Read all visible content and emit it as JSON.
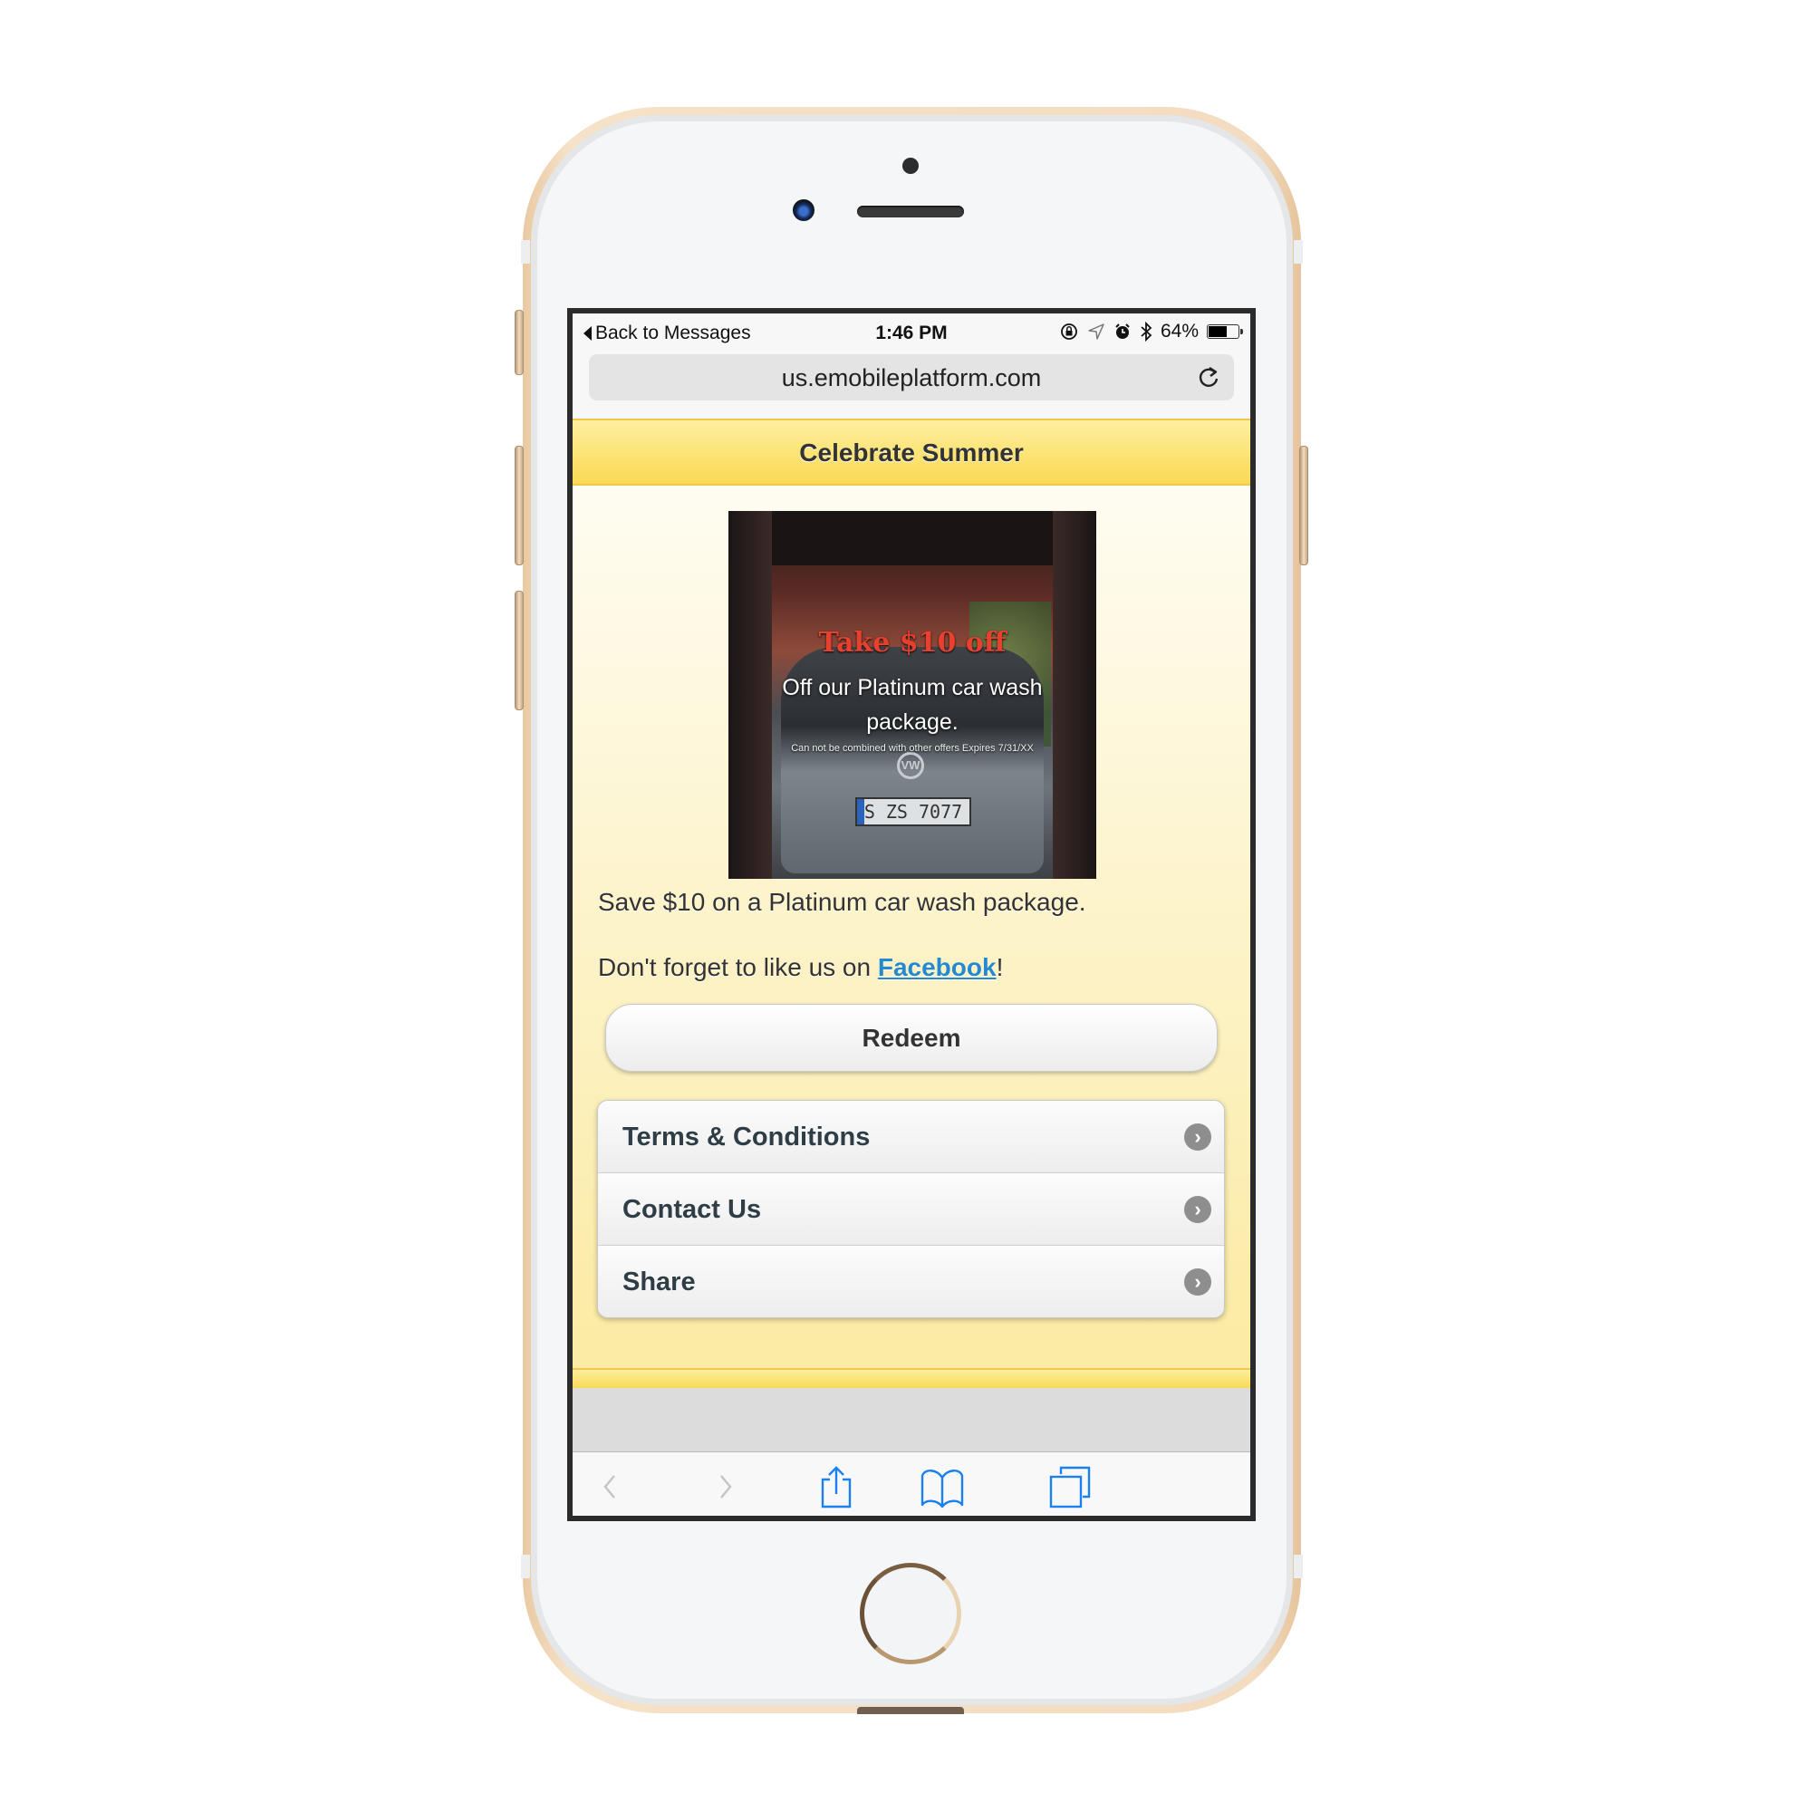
{
  "device": {
    "model": "iPhone",
    "finish": "gold"
  },
  "status_bar": {
    "back_label": "Back to Messages",
    "time": "1:46 PM",
    "icons": [
      "orientation-lock-icon",
      "location-icon",
      "alarm-icon",
      "bluetooth-icon"
    ],
    "battery_percent_label": "64%",
    "battery_level": 0.64
  },
  "browser": {
    "url": "us.emobileplatform.com",
    "reload_icon": "reload-icon",
    "toolbar": {
      "back_icon": "chevron-left-icon",
      "forward_icon": "chevron-right-icon",
      "share_icon": "share-icon",
      "bookmarks_icon": "book-icon",
      "tabs_icon": "tabs-icon"
    }
  },
  "page": {
    "header_title": "Celebrate Summer",
    "promo_image": {
      "headline": "Take $10 off",
      "subline": "Off our Platinum car wash package.",
      "fine_print": "Can not be combined with other offers Expires 7/31/XX",
      "plate": "S ZS 7077",
      "logo": "VW"
    },
    "description": "Save $10 on a Platinum car wash package.",
    "social_prefix": "Don't forget to like us on ",
    "social_link": "Facebook",
    "social_suffix": "!",
    "redeem_label": "Redeem",
    "menu": [
      {
        "label": "Terms & Conditions",
        "icon": "chevron-right-circle-icon"
      },
      {
        "label": "Contact Us",
        "icon": "chevron-right-circle-icon"
      },
      {
        "label": "Share",
        "icon": "chevron-right-circle-icon"
      }
    ],
    "colors": {
      "header_yellow": "#fbe271",
      "link_blue": "#2489ce",
      "toolbar_blue": "#1a82f0"
    }
  }
}
